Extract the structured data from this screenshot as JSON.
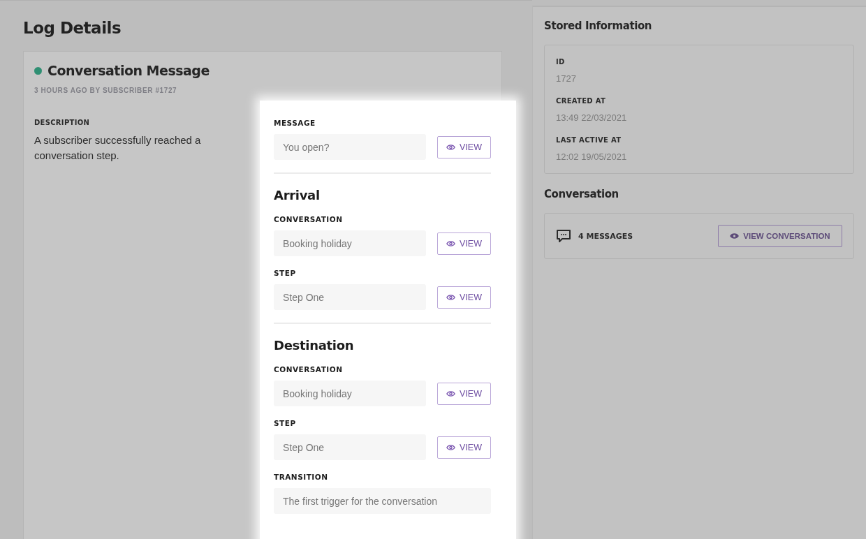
{
  "page_title": "Log Details",
  "card": {
    "title": "Conversation Message",
    "meta": "3 HOURS AGO BY SUBSCRIBER #1727",
    "description": {
      "label": "DESCRIPTION",
      "text": "A subscriber successfully reached a conversation step."
    },
    "message": {
      "label": "MESSAGE",
      "value": "You open?",
      "button": "VIEW"
    },
    "sections": [
      {
        "heading": "Arrival",
        "fields": [
          {
            "label": "CONVERSATION",
            "value": "Booking holiday",
            "button": "VIEW"
          },
          {
            "label": "STEP",
            "value": "Step One",
            "button": "VIEW"
          }
        ]
      },
      {
        "heading": "Destination",
        "fields": [
          {
            "label": "CONVERSATION",
            "value": "Booking holiday",
            "button": "VIEW"
          },
          {
            "label": "STEP",
            "value": "Step One",
            "button": "VIEW"
          },
          {
            "label": "TRANSITION",
            "value": "The first trigger for the conversation"
          }
        ]
      }
    ]
  },
  "sidebar": {
    "stored": {
      "title": "Stored Information",
      "items": [
        {
          "label": "ID",
          "value": "1727"
        },
        {
          "label": "CREATED AT",
          "value": "13:49 22/03/2021"
        },
        {
          "label": "LAST ACTIVE AT",
          "value": "12:02 19/05/2021"
        }
      ]
    },
    "conversation": {
      "title": "Conversation",
      "count": "4 MESSAGES",
      "button": "VIEW CONVERSATION"
    }
  }
}
